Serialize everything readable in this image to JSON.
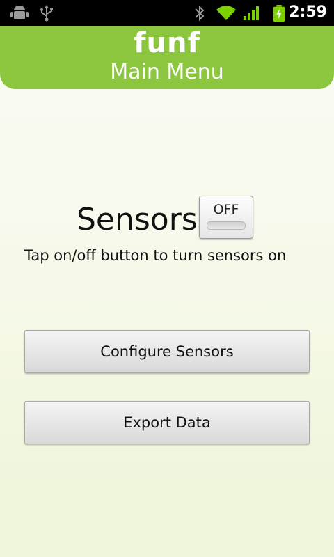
{
  "status_bar": {
    "time": "2:59",
    "icons": [
      "android-debug-icon",
      "usb-icon",
      "bluetooth-icon",
      "wifi-icon",
      "signal-icon",
      "battery-charging-icon"
    ]
  },
  "header": {
    "logo": "funf",
    "title": "Main Menu",
    "color": "#8cc63f"
  },
  "sensors": {
    "label": "Sensors",
    "toggle_label": "OFF",
    "state": "off",
    "hint": "Tap on/off button to turn sensors on"
  },
  "buttons": {
    "configure": "Configure Sensors",
    "export": "Export Data"
  }
}
